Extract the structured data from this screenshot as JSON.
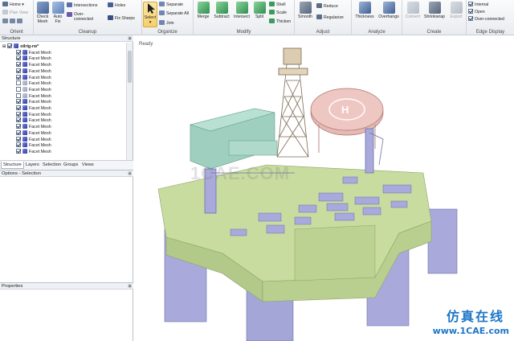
{
  "ribbon": {
    "home": "Home",
    "plan_view": "Plan View",
    "groups": {
      "orient": "Orient",
      "cleanup": "Cleanup",
      "organize": "Organize",
      "modify": "Modify",
      "adjust": "Adjust",
      "analyze": "Analyze",
      "create": "Create",
      "edge_display": "Edge Display"
    },
    "cleanup": {
      "check_mesh": "Check Mesh",
      "auto_fix": "Auto Fix",
      "intersections": "Intersections",
      "over_connected": "Over-connected",
      "holes": "Holes",
      "fix_sharps": "Fix Sharps"
    },
    "organize": {
      "select": "Select",
      "separate": "Separate",
      "separate_all": "Separate All",
      "join": "Join"
    },
    "modify": {
      "merge": "Merge",
      "subtract": "Subtract",
      "intersect": "Intersect",
      "split": "Split",
      "shell": "Shell",
      "scale": "Scale",
      "thicken": "Thicken"
    },
    "adjust": {
      "smooth": "Smooth",
      "reduce": "Reduce",
      "regularize": "Regularize"
    },
    "analyze": {
      "thickness": "Thickness",
      "overhangs": "Overhangs"
    },
    "create": {
      "convert": "Convert",
      "shrinkwrap": "Shrinkwrap",
      "export": "Export"
    },
    "edge_display": {
      "internal": "Internal",
      "open": "Open",
      "over_connected": "Over-connected"
    }
  },
  "structure": {
    "title": "Structure",
    "root": "oilrig-rw*",
    "items": [
      {
        "label": "Facet Mesh",
        "checked": true
      },
      {
        "label": "Facet Mesh",
        "checked": true
      },
      {
        "label": "Facet Mesh",
        "checked": true
      },
      {
        "label": "Facet Mesh",
        "checked": true
      },
      {
        "label": "Facet Mesh",
        "checked": true
      },
      {
        "label": "Facet Mesh",
        "checked": false
      },
      {
        "label": "Facet Mesh",
        "checked": false
      },
      {
        "label": "Facet Mesh",
        "checked": false
      },
      {
        "label": "Facet Mesh",
        "checked": true
      },
      {
        "label": "Facet Mesh",
        "checked": true
      },
      {
        "label": "Facet Mesh",
        "checked": true
      },
      {
        "label": "Facet Mesh",
        "checked": true
      },
      {
        "label": "Facet Mesh",
        "checked": true
      },
      {
        "label": "Facet Mesh",
        "checked": true
      },
      {
        "label": "Facet Mesh",
        "checked": true
      },
      {
        "label": "Facet Mesh",
        "checked": true
      },
      {
        "label": "Facet Mesh",
        "checked": true
      }
    ],
    "tabs": [
      "Structure",
      "Layers",
      "Selection",
      "Groups",
      "Views"
    ]
  },
  "options": {
    "title": "Options - Selection"
  },
  "properties": {
    "title": "Properties"
  },
  "viewport": {
    "status": "Ready",
    "watermark_center": "1CAE.COM",
    "watermark_cn": "仿真在线",
    "watermark_url": "www.1CAE.com"
  }
}
